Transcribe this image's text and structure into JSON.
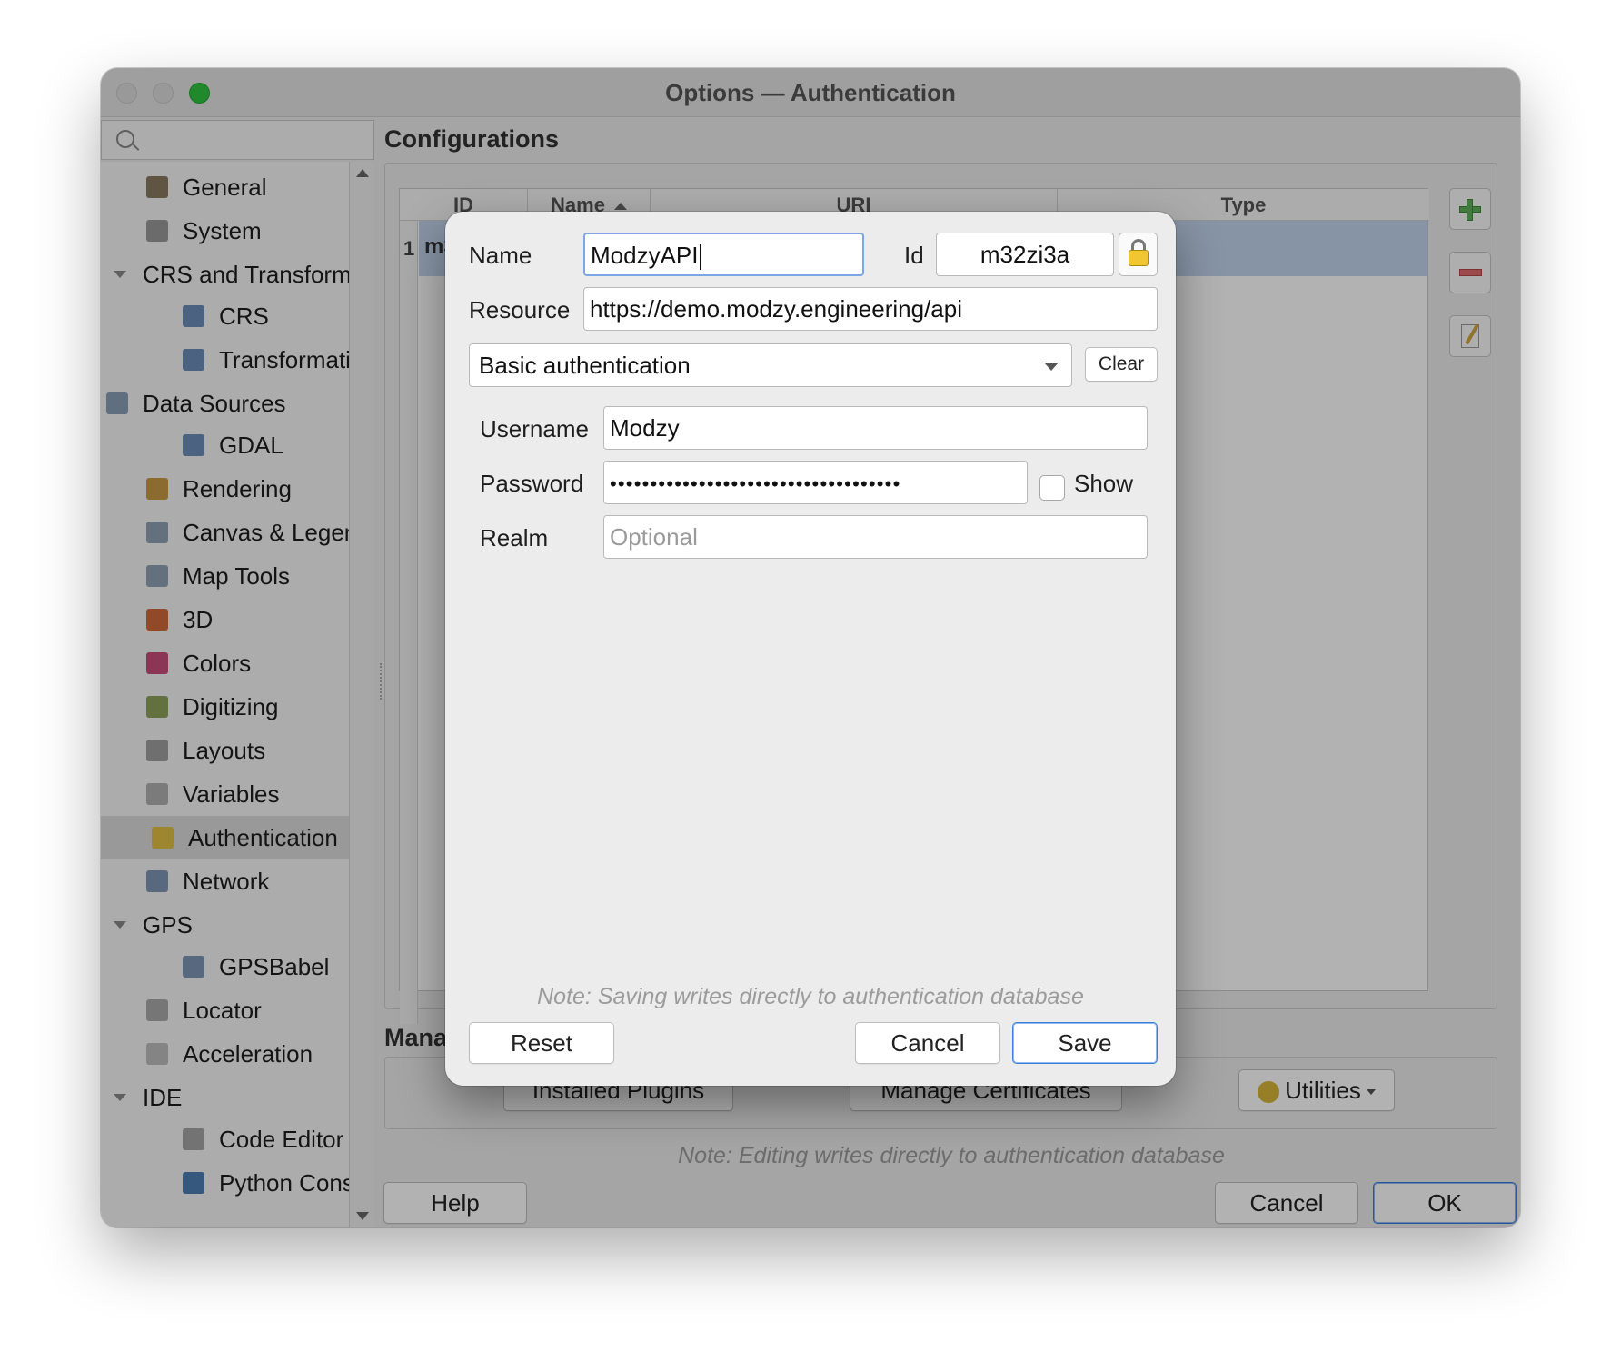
{
  "window": {
    "title": "Options — Authentication"
  },
  "search": {
    "placeholder": ""
  },
  "sidebar": {
    "items": [
      {
        "label": "General",
        "icon": "tools-icon"
      },
      {
        "label": "System",
        "icon": "gear-icon"
      },
      {
        "label": "CRS and Transforms",
        "icon": "",
        "group": true
      },
      {
        "label": "CRS",
        "icon": "globe-icon"
      },
      {
        "label": "Transformations",
        "icon": "globe-icon"
      },
      {
        "label": "Data Sources",
        "icon": "table-icon",
        "group": true
      },
      {
        "label": "GDAL",
        "icon": "globe-icon"
      },
      {
        "label": "Rendering",
        "icon": "brush-icon"
      },
      {
        "label": "Canvas & Legend",
        "icon": "map-icon"
      },
      {
        "label": "Map Tools",
        "icon": "map-icon"
      },
      {
        "label": "3D",
        "icon": "cube-icon"
      },
      {
        "label": "Colors",
        "icon": "palette-icon"
      },
      {
        "label": "Digitizing",
        "icon": "digitize-icon"
      },
      {
        "label": "Layouts",
        "icon": "layout-icon"
      },
      {
        "label": "Variables",
        "icon": "variable-icon"
      },
      {
        "label": "Authentication",
        "icon": "lock-icon",
        "selected": true
      },
      {
        "label": "Network",
        "icon": "network-icon"
      },
      {
        "label": "GPS",
        "icon": "",
        "group": true
      },
      {
        "label": "GPSBabel",
        "icon": "gps-icon"
      },
      {
        "label": "Locator",
        "icon": "search-icon"
      },
      {
        "label": "Acceleration",
        "icon": "chip-icon"
      },
      {
        "label": "IDE",
        "icon": "",
        "group": true
      },
      {
        "label": "Code Editor",
        "icon": "document-icon"
      },
      {
        "label": "Python Console",
        "icon": "python-icon"
      }
    ]
  },
  "configurations": {
    "title": "Configurations",
    "columns": [
      "ID",
      "Name",
      "URI",
      "Type"
    ],
    "rows": [
      {
        "num": "1",
        "id": "m32zi3a"
      }
    ]
  },
  "management": {
    "title": "Management",
    "installed_plugins": "Installed Plugins",
    "manage_certificates": "Manage Certificates",
    "utilities": "Utilities"
  },
  "main_footer": {
    "note": "Note: Editing writes directly to authentication database",
    "help": "Help",
    "cancel": "Cancel",
    "ok": "OK"
  },
  "dialog": {
    "name_label": "Name",
    "name_value": "ModzyAPI",
    "id_label": "Id",
    "id_value": "m32zi3a",
    "resource_label": "Resource",
    "resource_value": "https://demo.modzy.engineering/api",
    "method_value": "Basic authentication",
    "clear_label": "Clear",
    "username_label": "Username",
    "username_value": "Modzy",
    "password_label": "Password",
    "password_value": "••••••••••••••••••••••••••••••••••••",
    "show_label": "Show",
    "realm_label": "Realm",
    "realm_placeholder": "Optional",
    "note": "Note: Saving writes directly to authentication database",
    "reset": "Reset",
    "cancel": "Cancel",
    "save": "Save"
  },
  "colors": {
    "accent": "#3a7fd8",
    "selection": "#c2d4ec",
    "close_button": "#2fc540"
  }
}
